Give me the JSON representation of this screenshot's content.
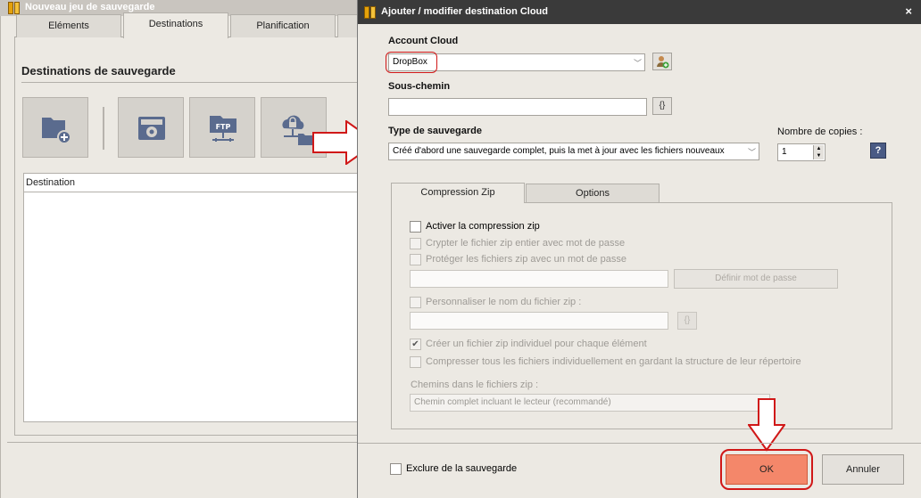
{
  "background_window": {
    "title": "Nouveau jeu de sauvegarde",
    "tabs": [
      "Eléments",
      "Destinations",
      "Planification"
    ],
    "active_tab": "Destinations",
    "section_title": "Destinations de sauvegarde",
    "destination_buttons": [
      {
        "icon": "local-folder-add-icon"
      },
      {
        "icon": "removable-drive-icon"
      },
      {
        "icon": "ftp-server-icon"
      },
      {
        "icon": "cloud-lock-folder-icon"
      }
    ],
    "list_header": "Destination"
  },
  "dialog": {
    "title": "Ajouter / modifier destination Cloud",
    "close_glyph": "×",
    "account_label": "Account Cloud",
    "account_value": "DropBox",
    "subpath_label": "Sous-chemin",
    "subpath_value": "",
    "variables_btn": "{}",
    "backup_type_label": "Type de sauvegarde",
    "backup_type_value": "Créé d'abord une sauvegarde complet, puis la met à jour avec les fichiers nouveaux",
    "copies_label": "Nombre de copies :",
    "copies_value": "1",
    "help_btn": "?",
    "tabs": [
      "Compression Zip",
      "Options"
    ],
    "active_tab": "Compression Zip",
    "zip": {
      "enable": {
        "label": "Activer la compression zip",
        "checked": false,
        "enabled": true
      },
      "encrypt": {
        "label": "Crypter le fichier zip entier avec mot de passe",
        "checked": false,
        "enabled": false
      },
      "protect": {
        "label": "Protéger les fichiers zip avec un mot de passe",
        "checked": false,
        "enabled": false
      },
      "password_value": "",
      "set_password_btn": "Définir mot de passe",
      "custom_name": {
        "label": "Personnaliser le nom du fichier zip :",
        "checked": false,
        "enabled": false
      },
      "zip_name_value": "",
      "zip_name_var_btn": "{}",
      "per_item": {
        "label": "Créer un fichier zip individuel pour chaque élément",
        "checked": true,
        "enabled": false
      },
      "individual": {
        "label": "Compresser tous les fichiers individuellement en gardant la structure de leur répertoire",
        "checked": false,
        "enabled": false
      },
      "paths_label": "Chemins dans le fichiers zip :",
      "paths_value": "Chemin complet incluant le lecteur (recommandé)"
    },
    "exclude_label": "Exclure de la sauvegarde",
    "ok_label": "OK",
    "cancel_label": "Annuler",
    "check_glyph": "✔",
    "combo_arrow": "﹀"
  }
}
